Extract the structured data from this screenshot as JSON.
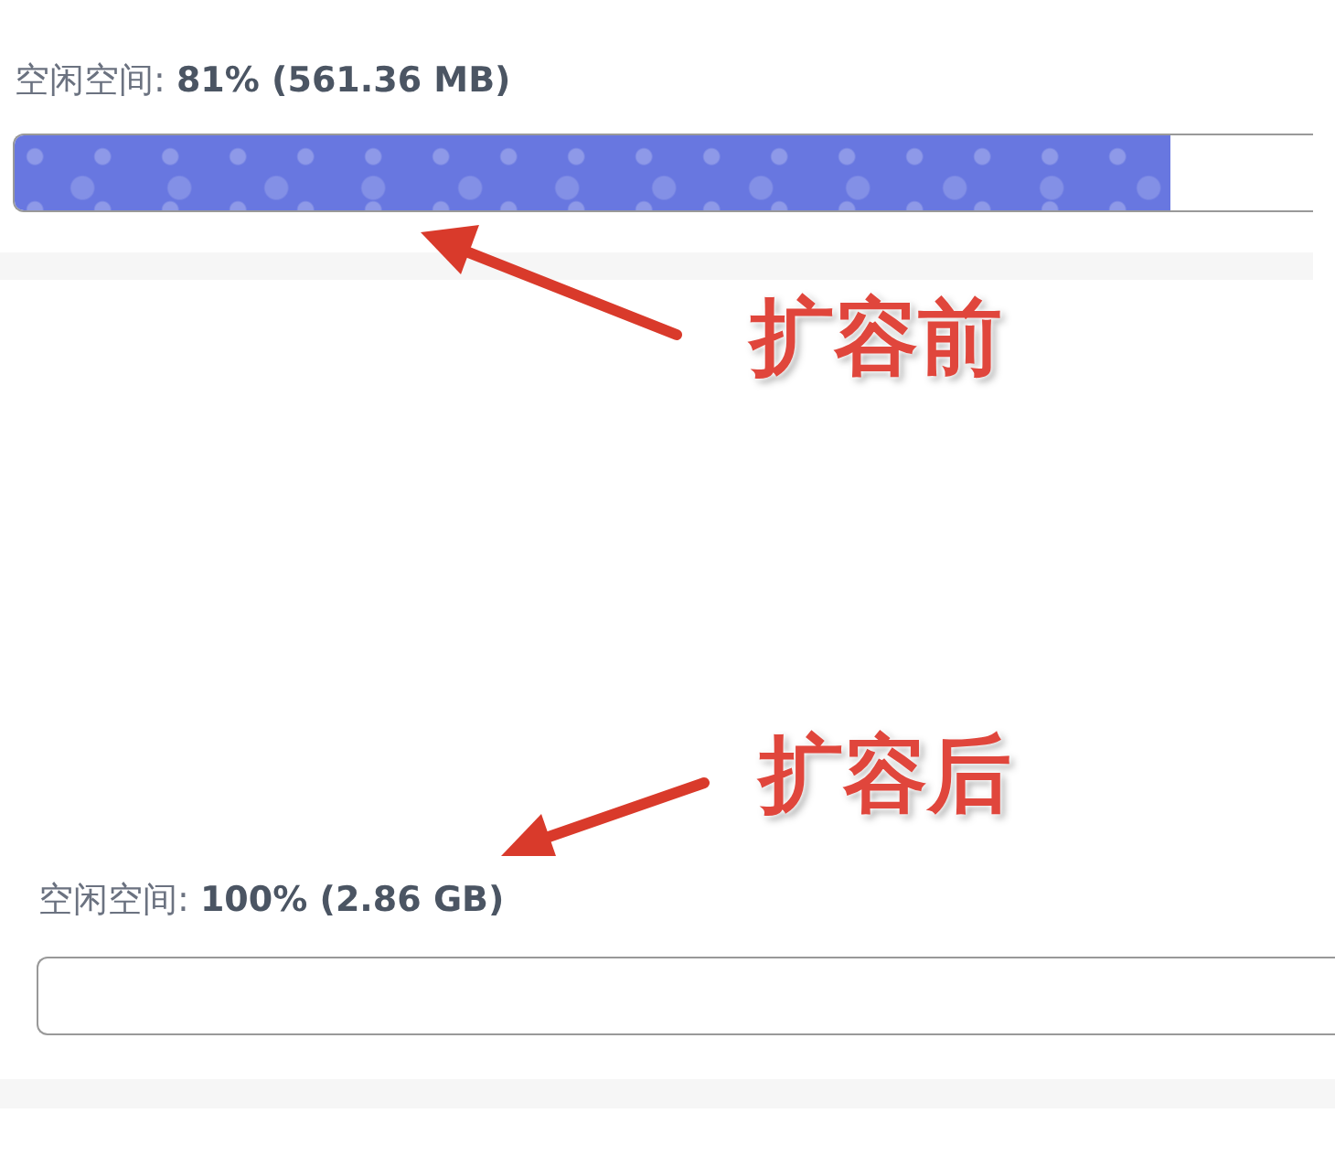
{
  "panels": [
    {
      "label": "空闲空间: **81% (561.36 MB)**",
      "level": 0.89,
      "note": "扩容前"
    },
    {
      "label": "空闲空间: **100% (2.86 GB)**",
      "level": 0,
      "note": "扩容后"
    }
  ]
}
